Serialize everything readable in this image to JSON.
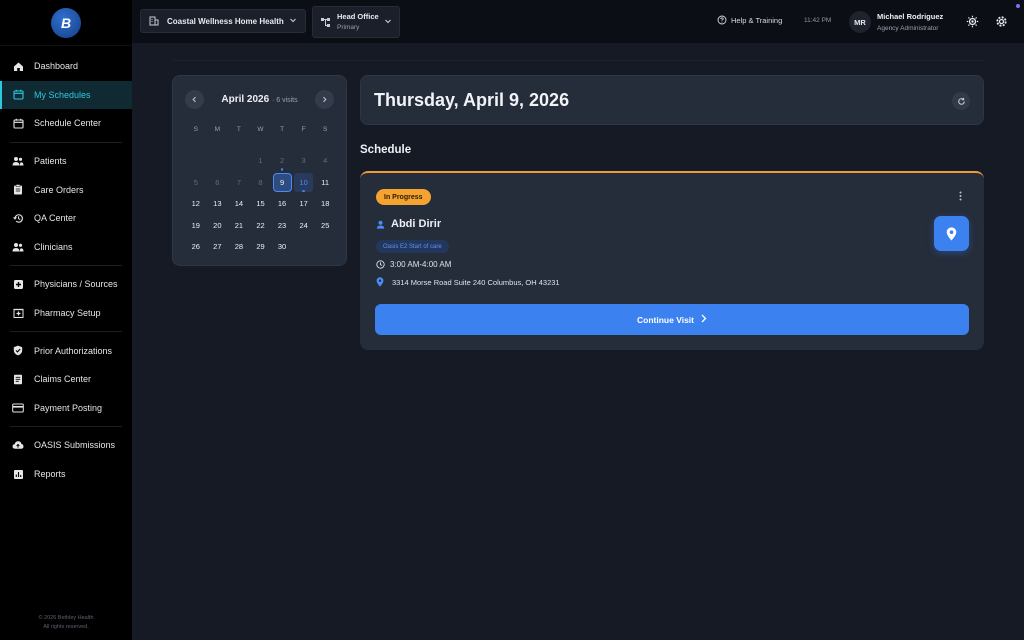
{
  "brand": {
    "logo_text": "B"
  },
  "sidebar": {
    "items": [
      {
        "label": "Dashboard",
        "icon": "home-icon"
      },
      {
        "label": "My Schedules",
        "icon": "calendar-icon",
        "active": true
      },
      {
        "label": "Schedule Center",
        "icon": "calendar-icon"
      },
      {
        "label": "Patients",
        "icon": "people-icon"
      },
      {
        "label": "Care Orders",
        "icon": "clipboard-icon"
      },
      {
        "label": "QA Center",
        "icon": "history-icon"
      },
      {
        "label": "Clinicians",
        "icon": "people-icon"
      },
      {
        "label": "Physicians / Sources",
        "icon": "medical-plus-icon"
      },
      {
        "label": "Pharmacy Setup",
        "icon": "pharmacy-icon"
      },
      {
        "label": "Prior Authorizations",
        "icon": "shield-check-icon"
      },
      {
        "label": "Claims Center",
        "icon": "document-icon"
      },
      {
        "label": "Payment Posting",
        "icon": "credit-card-icon"
      },
      {
        "label": "OASIS Submissions",
        "icon": "cloud-upload-icon"
      },
      {
        "label": "Reports",
        "icon": "chart-icon"
      }
    ],
    "footer_line1": "© 2026 Bethley Health",
    "footer_line2": "All rights reserved."
  },
  "header": {
    "org": "Coastal Wellness Home Health",
    "office_name": "Head Office",
    "office_sub": "Primary",
    "help": "Help & Training",
    "time": "11:42 PM",
    "avatar_initials": "MR",
    "user_name": "Michael Rodriguez",
    "user_role": "Agency Administrator"
  },
  "calendar": {
    "month": "April 2026",
    "visits": "· 6 visits",
    "dow": [
      "S",
      "M",
      "T",
      "W",
      "T",
      "F",
      "S"
    ],
    "days": [
      {
        "d": "",
        "dim": true
      },
      {
        "d": "",
        "dim": true
      },
      {
        "d": "",
        "dim": true
      },
      {
        "d": "1",
        "dim": true
      },
      {
        "d": "2",
        "dim": true,
        "mark": true
      },
      {
        "d": "3",
        "dim": true
      },
      {
        "d": "4",
        "dim": true
      },
      {
        "d": "5",
        "dim": true
      },
      {
        "d": "6",
        "dim": true
      },
      {
        "d": "7",
        "dim": true
      },
      {
        "d": "8",
        "dim": true
      },
      {
        "d": "9",
        "selected": true
      },
      {
        "d": "10",
        "tenth": true,
        "mark": true
      },
      {
        "d": "11"
      },
      {
        "d": "12"
      },
      {
        "d": "13"
      },
      {
        "d": "14"
      },
      {
        "d": "15"
      },
      {
        "d": "16"
      },
      {
        "d": "17"
      },
      {
        "d": "18"
      },
      {
        "d": "19"
      },
      {
        "d": "20"
      },
      {
        "d": "21"
      },
      {
        "d": "22"
      },
      {
        "d": "23"
      },
      {
        "d": "24"
      },
      {
        "d": "25"
      },
      {
        "d": "26"
      },
      {
        "d": "27"
      },
      {
        "d": "28"
      },
      {
        "d": "29"
      },
      {
        "d": "30"
      }
    ]
  },
  "main": {
    "date_title": "Thursday, April 9, 2026",
    "section_title": "Schedule",
    "visit": {
      "status": "In Progress",
      "patient": "Abdi Dirir",
      "visit_type": "Oasis E2 Start of care",
      "time": "3:00 AM-4:00 AM",
      "address": "3314 Morse Road Suite 240 Columbus, OH 43231",
      "continue_label": "Continue Visit"
    }
  },
  "colors": {
    "accent": "#3b82f0",
    "active_nav": "#2cc8dc",
    "status_in_progress": "#f4a331"
  }
}
